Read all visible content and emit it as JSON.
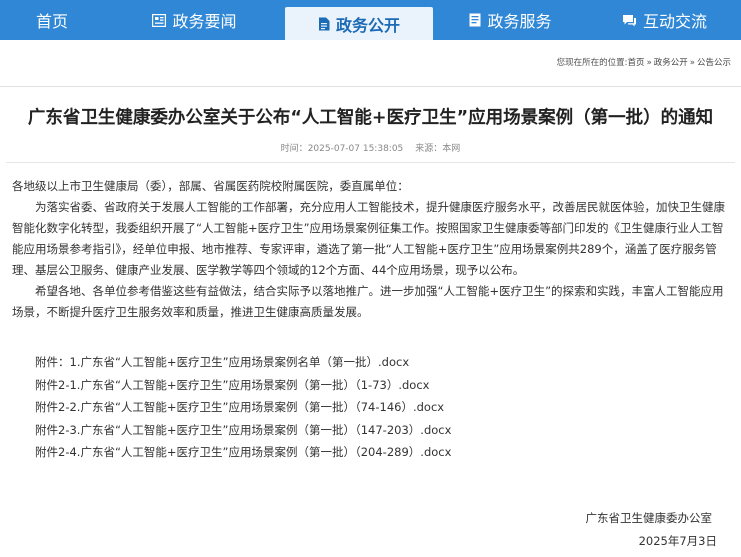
{
  "nav": {
    "items": [
      {
        "label": "首页",
        "icon": "home-icon"
      },
      {
        "label": "政务要闻",
        "icon": "news-icon"
      },
      {
        "label": "政务公开",
        "icon": "document-icon"
      },
      {
        "label": "政务服务",
        "icon": "service-icon"
      },
      {
        "label": "互动交流",
        "icon": "chat-icon"
      }
    ],
    "active_index": 2,
    "colors": {
      "bar": "#2f87d6",
      "active_bg": "#eaf3fb",
      "active_text": "#1b6bb6"
    }
  },
  "breadcrumb": {
    "prefix": "您现在所在的位置:",
    "items": [
      "首页",
      "政务公开",
      "公告公示"
    ],
    "separator": "»"
  },
  "article": {
    "title": "广东省卫生健康委办公室关于公布“人工智能+医疗卫生”应用场景案例（第一批）的通知",
    "time_label": "时间：",
    "time_value": "2025-07-07 15:38:05",
    "source_label": "来源：",
    "source_value": "本网",
    "salutation": "各地级以上市卫生健康局（委），部属、省属医药院校附属医院，委直属单位：",
    "paragraph1": "为落实省委、省政府关于发展人工智能的工作部署，充分应用人工智能技术，提升健康医疗服务水平，改善居民就医体验，加快卫生健康智能化数字化转型，我委组织开展了“人工智能+医疗卫生”应用场景案例征集工作。按照国家卫生健康委等部门印发的《卫生健康行业人工智能应用场景参考指引》，经单位申报、地市推荐、专家评审，遴选了第一批“人工智能+医疗卫生”应用场景案例共289个，涵盖了医疗服务管理、基层公卫服务、健康产业发展、医学教学等四个领域的12个方面、44个应用场景，现予以公布。",
    "paragraph2": "希望各地、各单位参考借鉴这些有益做法，结合实际予以落地推广。进一步加强“人工智能+医疗卫生”的探索和实践，丰富人工智能应用场景，不断提升医疗卫生服务效率和质量，推进卫生健康高质量发展。",
    "attachments": [
      "附件：1.广东省“人工智能+医疗卫生”应用场景案例名单（第一批）.docx",
      "附件2-1.广东省“人工智能+医疗卫生”应用场景案例（第一批）（1-73）.docx",
      "附件2-2.广东省“人工智能+医疗卫生”应用场景案例（第一批）（74-146）.docx",
      "附件2-3.广东省“人工智能+医疗卫生”应用场景案例（第一批）（147-203）.docx",
      "附件2-4.广东省“人工智能+医疗卫生”应用场景案例（第一批）（204-289）.docx"
    ],
    "signature_org": "广东省卫生健康委办公室",
    "signature_date": "2025年7月3日"
  }
}
